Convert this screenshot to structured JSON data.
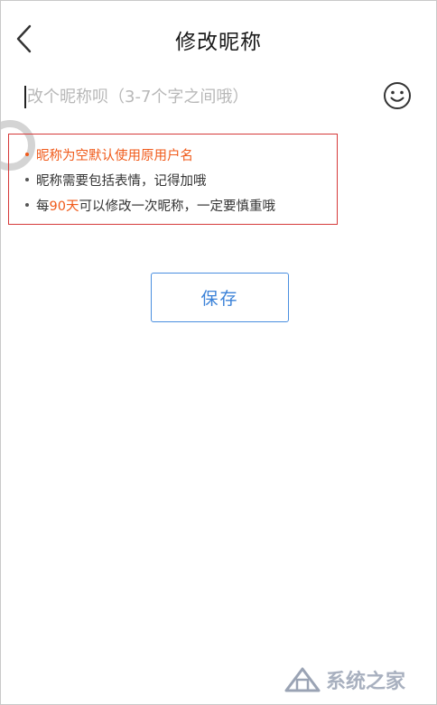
{
  "header": {
    "title": "修改昵称"
  },
  "nickname": {
    "placeholder": "改个昵称呗（3-7个字之间哦）",
    "value": ""
  },
  "tips": {
    "tip1": "昵称为空默认使用原用户名",
    "tip2": "昵称需要包括表情，记得加哦",
    "tip3_prefix": "每",
    "tip3_highlight": "90天",
    "tip3_suffix": "可以修改一次昵称，一定要慎重哦"
  },
  "actions": {
    "save_label": "保存"
  },
  "watermark": {
    "text": "系统之家"
  },
  "colors": {
    "accent_blue": "#3b82d8",
    "warning_orange": "#f05a1a",
    "highlight_border": "#d63a3a"
  },
  "icons": {
    "back": "chevron-left-icon",
    "emoji": "smiley-icon"
  }
}
